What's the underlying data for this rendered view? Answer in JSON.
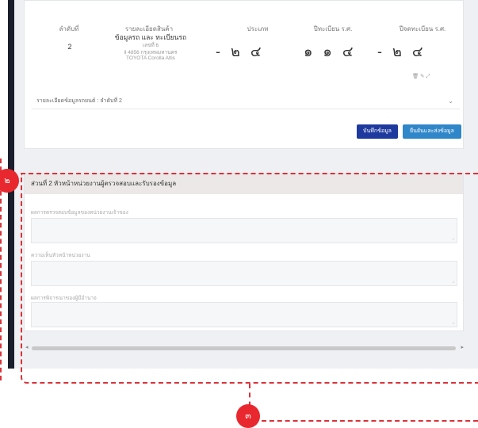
{
  "table": {
    "headers": [
      "ลำดับที่",
      "รายละเอียดสินค้า",
      "ประเภท",
      "ปีทะเบียน ร.ศ.",
      "ปีจดทะเบียน ร.ศ."
    ],
    "row": {
      "index": "2",
      "product_line1": "ข้อมูลรถ และ ทะเบียนรถ",
      "product_line2": "เลขที่ 6",
      "product_line3": "ll 4856 กรุงเทพมหานคร",
      "product_line4": "TOYOTA Corolla Altis",
      "col_type": "- ๒ ๔",
      "col_year_reg": "๑ ๑ ๔",
      "col_year_reg2": "- ๒ ๔"
    }
  },
  "row_actions": "🗑 ✎ ⤢",
  "accordion": {
    "label": "รายละเอียดข้อมูลรถยนต์ : ลำดับที่ 2"
  },
  "buttons": {
    "save": "บันทึกข้อมูล",
    "submit": "ยืนยันและส่งข้อมูล"
  },
  "section2": {
    "title": "ส่วนที่ 2 หัวหน้าหน่วยงานผู้ตรวจสอบและรับรองข้อมูล",
    "fields": [
      {
        "label": "ผลการตรวจสอบข้อมูลของหน่วยงานเจ้าของ"
      },
      {
        "label": "ความเห็นหัวหน้าหน่วยงาน"
      },
      {
        "label": "ผลการพิจารณาของผู้มีอำนาจ"
      }
    ]
  },
  "annotations": {
    "badge2": "๒",
    "badge3": "๓"
  },
  "colors": {
    "annotation": "#d9323a",
    "save_button": "#1e3a9e",
    "submit_button": "#2f86c8"
  }
}
